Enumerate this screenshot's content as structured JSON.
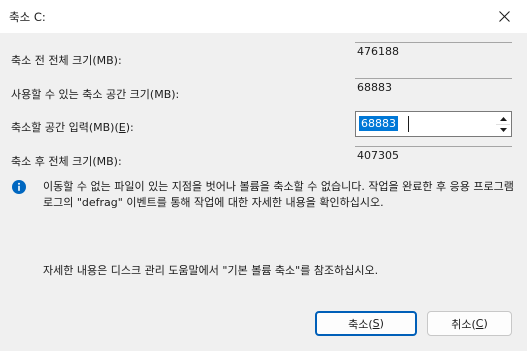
{
  "window": {
    "title": "축소 C:"
  },
  "fields": {
    "total_before": {
      "label": "축소 전 전체 크기(MB):",
      "value": "476188"
    },
    "available": {
      "label": "사용할 수 있는 축소 공간 크기(MB):",
      "value": "68883"
    },
    "shrink_amount": {
      "label_prefix": "축소할 공간 입력(MB)(",
      "label_key": "E",
      "label_suffix": "):",
      "value": "68883"
    },
    "total_after": {
      "label": "축소 후 전체 크기(MB):",
      "value": "407305"
    }
  },
  "info": {
    "message": "이동할 수 없는 파일이 있는 지점을 벗어나 볼륨을 축소할 수 없습니다. 작업을 완료한 후 응용 프로그램 로그의 \"defrag\" 이벤트를 통해 작업에 대한 자세한 내용을 확인하십시오.",
    "help": "자세한 내용은 디스크 관리 도움말에서 \"기본 볼륨 축소\"를 참조하십시오."
  },
  "buttons": {
    "shrink": {
      "prefix": "축소(",
      "key": "S",
      "suffix": ")"
    },
    "cancel": {
      "prefix": "취소(",
      "key": "C",
      "suffix": ")"
    }
  },
  "colors": {
    "accent": "#005fb8",
    "info_icon": "#0067c0",
    "selection": "#0078d7"
  },
  "icons": {
    "close": "close-icon",
    "info": "info-icon",
    "spin_up": "chevron-up-icon",
    "spin_down": "chevron-down-icon"
  }
}
